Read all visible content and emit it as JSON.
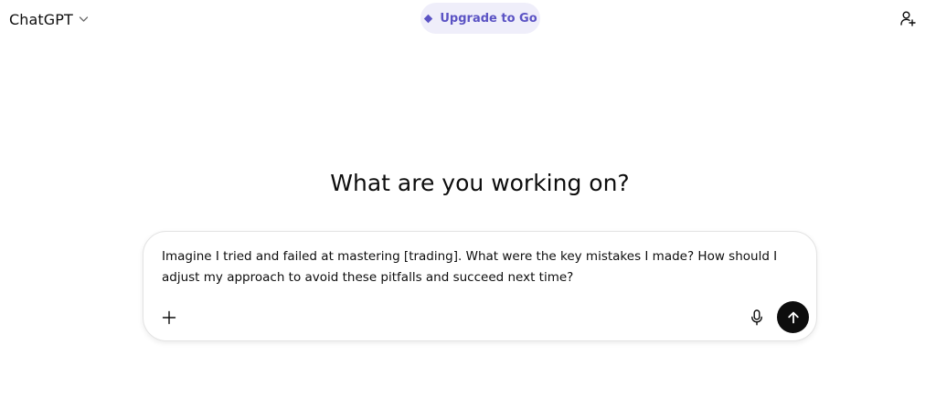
{
  "header": {
    "model_label": "ChatGPT",
    "upgrade_label": "Upgrade to Go",
    "icons": {
      "model_dropdown": "chevron-down-icon",
      "upgrade": "diamond-icon",
      "add_user": "add-user-icon"
    }
  },
  "main": {
    "heading": "What are you working on?"
  },
  "composer": {
    "value": "Imagine I tried and failed at mastering [trading]. What were the key mistakes I made? How should I adjust my approach to avoid these pitfalls and succeed next time?",
    "icons": {
      "attach": "plus-icon",
      "voice": "microphone-icon",
      "send": "arrow-up-icon"
    }
  },
  "colors": {
    "upgrade_bg": "#efeefa",
    "upgrade_text": "#5b53c4",
    "send_bg": "#0d0d0d",
    "text": "#0d0d0d"
  }
}
